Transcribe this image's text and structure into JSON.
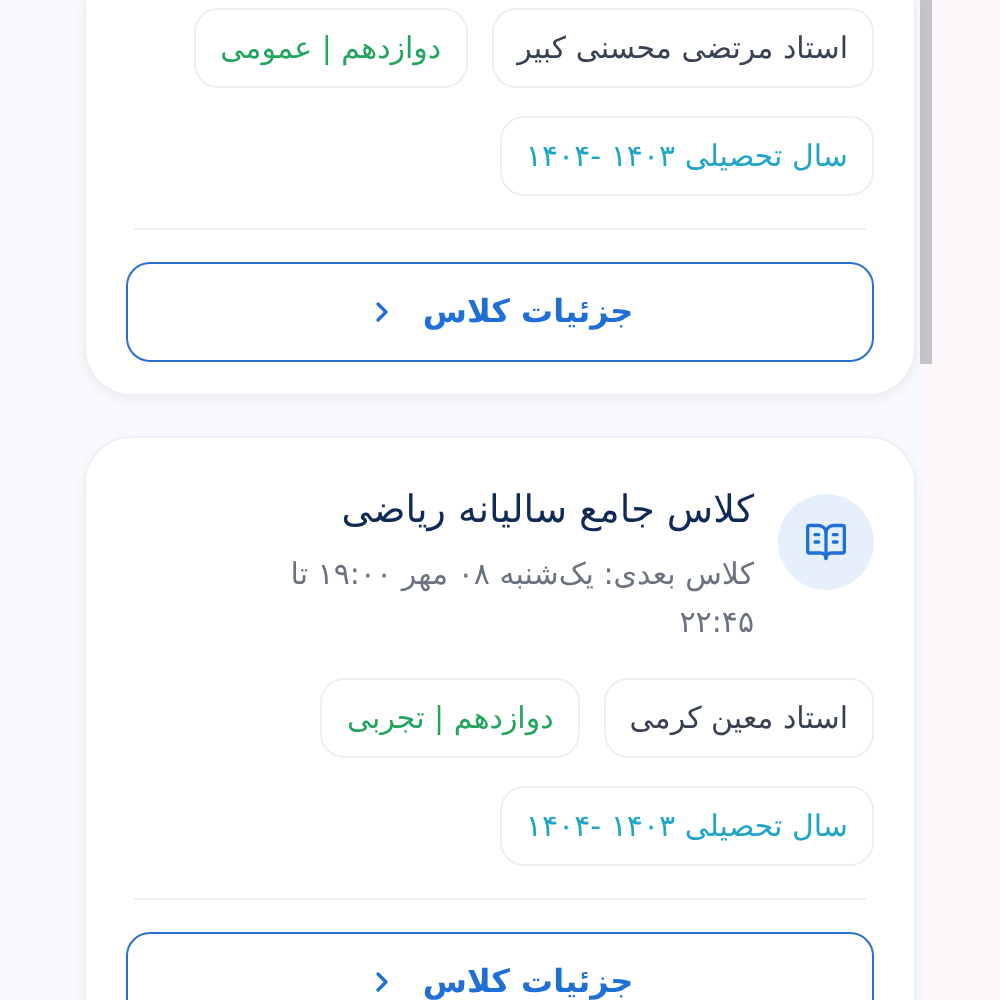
{
  "cards": [
    {
      "partial": true,
      "chips": [
        {
          "kind": "teacher",
          "label": "استاد مرتضی محسنی کبیر"
        },
        {
          "kind": "grade",
          "label": "دوازدهم | عمومی"
        },
        {
          "kind": "year",
          "label": "سال تحصیلی ۱۴۰۳ -۱۴۰۴"
        }
      ],
      "button": "جزئیات کلاس"
    },
    {
      "partial": false,
      "title": "کلاس جامع سالیانه ریاضی",
      "next_session": "کلاس بعدی: یک‌شنبه ۰۸ مهر ۱۹:۰۰ تا ۲۲:۴۵",
      "chips": [
        {
          "kind": "teacher",
          "label": "استاد معین کرمی"
        },
        {
          "kind": "grade",
          "label": "دوازدهم | تجربی"
        },
        {
          "kind": "year",
          "label": "سال تحصیلی ۱۴۰۳ -۱۴۰۴"
        }
      ],
      "button": "جزئیات کلاس"
    }
  ]
}
